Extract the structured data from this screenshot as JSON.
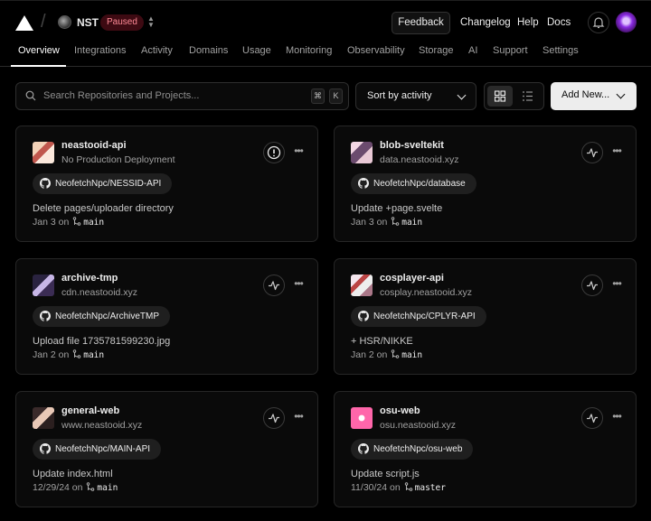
{
  "header": {
    "team_name": "NST",
    "team_status": "Paused",
    "feedback_label": "Feedback",
    "links": [
      "Changelog",
      "Help",
      "Docs"
    ]
  },
  "tabs": [
    "Overview",
    "Integrations",
    "Activity",
    "Domains",
    "Usage",
    "Monitoring",
    "Observability",
    "Storage",
    "AI",
    "Support",
    "Settings"
  ],
  "active_tab": "Overview",
  "toolbar": {
    "search_placeholder": "Search Repositories and Projects...",
    "kbd_1": "⌘",
    "kbd_2": "K",
    "sort_label": "Sort by activity",
    "add_new_label": "Add New..."
  },
  "projects": [
    {
      "name": "neastooid-api",
      "domain": "No Production Deployment",
      "repo": "NeofetchNpc/NESSID-API",
      "commit": "Delete pages/uploader directory",
      "date": "Jan 3",
      "branch": "main",
      "on": "on",
      "status_icon": "alert-icon"
    },
    {
      "name": "blob-sveltekit",
      "domain": "data.neastooid.xyz",
      "repo": "NeofetchNpc/database",
      "commit": "Update +page.svelte",
      "date": "Jan 3",
      "branch": "main",
      "on": "on",
      "status_icon": "activity-icon"
    },
    {
      "name": "archive-tmp",
      "domain": "cdn.neastooid.xyz",
      "repo": "NeofetchNpc/ArchiveTMP",
      "commit": "Upload file 1735781599230.jpg",
      "date": "Jan 2",
      "branch": "main",
      "on": "on",
      "status_icon": "activity-icon"
    },
    {
      "name": "cosplayer-api",
      "domain": "cosplay.neastooid.xyz",
      "repo": "NeofetchNpc/CPLYR-API",
      "commit": "+ HSR/NIKKE",
      "date": "Jan 2",
      "branch": "main",
      "on": "on",
      "status_icon": "activity-icon"
    },
    {
      "name": "general-web",
      "domain": "www.neastooid.xyz",
      "repo": "NeofetchNpc/MAIN-API",
      "commit": "Update index.html",
      "date": "12/29/24",
      "branch": "main",
      "on": "on",
      "status_icon": "activity-icon"
    },
    {
      "name": "osu-web",
      "domain": "osu.neastooid.xyz",
      "repo": "NeofetchNpc/osu-web",
      "commit": "Update script.js",
      "date": "11/30/24",
      "branch": "master",
      "on": "on",
      "status_icon": "activity-icon"
    }
  ],
  "colors": {
    "background": "#000000",
    "card_background": "#0a0a0a",
    "paused_badge": "#3d0a12",
    "paused_text": "#ff8a96"
  }
}
